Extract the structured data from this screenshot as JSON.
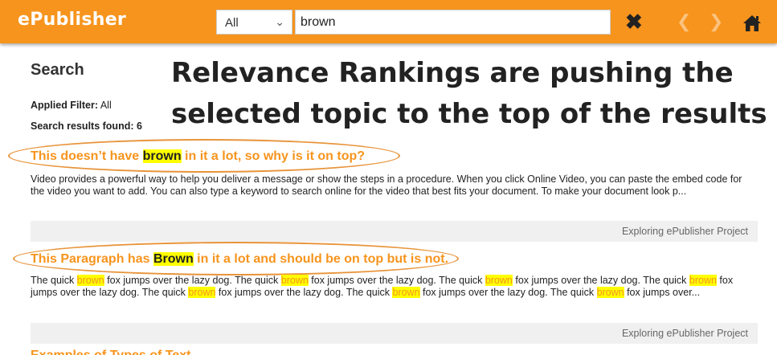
{
  "header": {
    "app_title": "ePublisher",
    "scope_select": {
      "value": "All"
    },
    "search_value": "brown",
    "close_icon": "close-icon",
    "prev_icon": "chevron-left-icon",
    "next_icon": "chevron-right-icon",
    "home_icon": "home-icon"
  },
  "sidebar": {
    "heading": "Search",
    "applied_filter_label": "Applied Filter:",
    "applied_filter_value": "All",
    "results_label": "Search results found:",
    "results_count": "6"
  },
  "annotation": {
    "line1": "Relevance Rankings are pushing the",
    "line2": "selected topic to the top of the results"
  },
  "results": [
    {
      "title_before": "This doesn’t have ",
      "title_highlight": "brown",
      "title_after": " in it a lot, so why is it on top?",
      "body": "Video provides a powerful way to help you deliver a message or show the steps in a procedure. When you click Online Video, you can paste the embed code for the video you want to add. You can also type a keyword to search online for the video that best fits your document. To make your document look p...",
      "source": "Exploring ePublisher Project"
    },
    {
      "title_before": "This Paragraph has ",
      "title_highlight": "Brown",
      "title_after": " in it a lot and should be on top but is not.",
      "body_parts": [
        "The quick ",
        "brown",
        " fox jumps over the lazy dog. The quick ",
        "brown",
        " fox jumps over the lazy dog. The quick ",
        "brown",
        " fox jumps over the lazy dog. The quick ",
        "brown",
        " fox jumps over the lazy dog. The quick ",
        "brown",
        " fox jumps over the lazy dog. The quick ",
        "brown",
        " fox jumps over the lazy dog. The quick ",
        "brown",
        " fox jumps over..."
      ],
      "source": "Exploring ePublisher Project"
    },
    {
      "title": "Examples of Types of Text"
    }
  ],
  "colors": {
    "brand": "#f7941d",
    "highlight": "#ffff00",
    "annotation_ellipse": "#e8943a"
  }
}
